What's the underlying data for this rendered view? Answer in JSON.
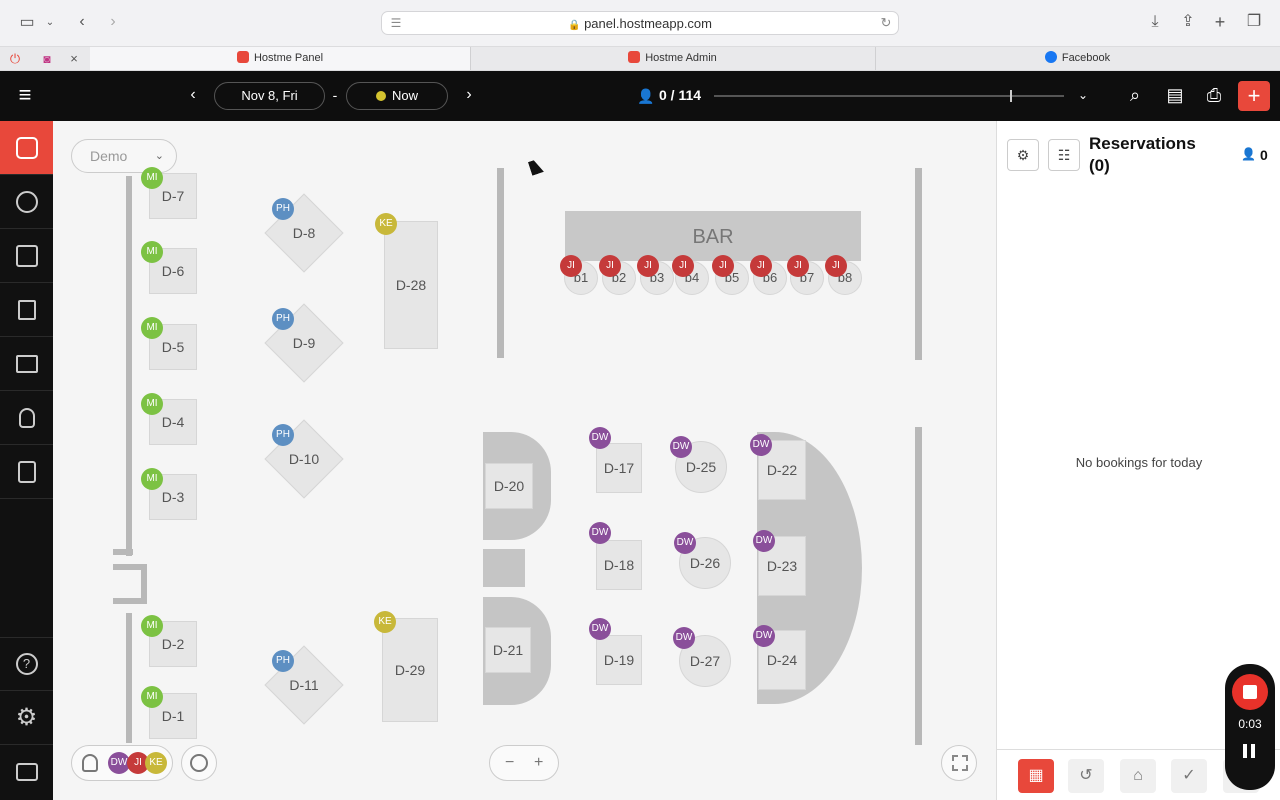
{
  "browser": {
    "url": "panel.hostmeapp.com",
    "tabs": [
      {
        "label": "Hostme Panel"
      },
      {
        "label": "Hostme Admin"
      },
      {
        "label": "Facebook"
      }
    ],
    "close_symbol": "×"
  },
  "header": {
    "date_label": "Nov 8, Fri",
    "separator": "-",
    "time_label": "Now",
    "guest_count": "0 / 114",
    "add_symbol": "+"
  },
  "floor": {
    "selector_label": "Demo",
    "bar_label": "BAR",
    "tables": [
      {
        "name": "D-7",
        "server": "MI"
      },
      {
        "name": "D-6",
        "server": "MI"
      },
      {
        "name": "D-5",
        "server": "MI"
      },
      {
        "name": "D-4",
        "server": "MI"
      },
      {
        "name": "D-3",
        "server": "MI"
      },
      {
        "name": "D-2",
        "server": "MI"
      },
      {
        "name": "D-1",
        "server": "MI"
      },
      {
        "name": "D-8",
        "server": "PH"
      },
      {
        "name": "D-9",
        "server": "PH"
      },
      {
        "name": "D-10",
        "server": "PH"
      },
      {
        "name": "D-11",
        "server": "PH"
      },
      {
        "name": "D-28",
        "server": "KE"
      },
      {
        "name": "D-29",
        "server": "KE"
      },
      {
        "name": "D-20",
        "server": ""
      },
      {
        "name": "D-21",
        "server": ""
      },
      {
        "name": "D-17",
        "server": "DW"
      },
      {
        "name": "D-18",
        "server": "DW"
      },
      {
        "name": "D-19",
        "server": "DW"
      },
      {
        "name": "D-25",
        "server": "DW"
      },
      {
        "name": "D-26",
        "server": "DW"
      },
      {
        "name": "D-27",
        "server": "DW"
      },
      {
        "name": "D-22",
        "server": "DW"
      },
      {
        "name": "D-23",
        "server": "DW"
      },
      {
        "name": "D-24",
        "server": "DW"
      }
    ],
    "bar_seats": [
      "b1",
      "b2",
      "b3",
      "b4",
      "b5",
      "b6",
      "b7",
      "b8"
    ],
    "bar_server": "JI",
    "legend_servers": [
      "DW",
      "JI",
      "KE"
    ],
    "zoom_out": "−",
    "zoom_in": "+"
  },
  "reservations": {
    "title": "Reservations",
    "count_label": "(0)",
    "guest_total": "0",
    "empty_message": "No bookings for today"
  },
  "recording": {
    "elapsed": "0:03"
  },
  "colors": {
    "accent": "#e8483b",
    "MI": "#7cc243",
    "PH": "#5d8fc2",
    "KE": "#c8b83a",
    "DW": "#8a4f9a",
    "JI": "#c53a3a"
  }
}
